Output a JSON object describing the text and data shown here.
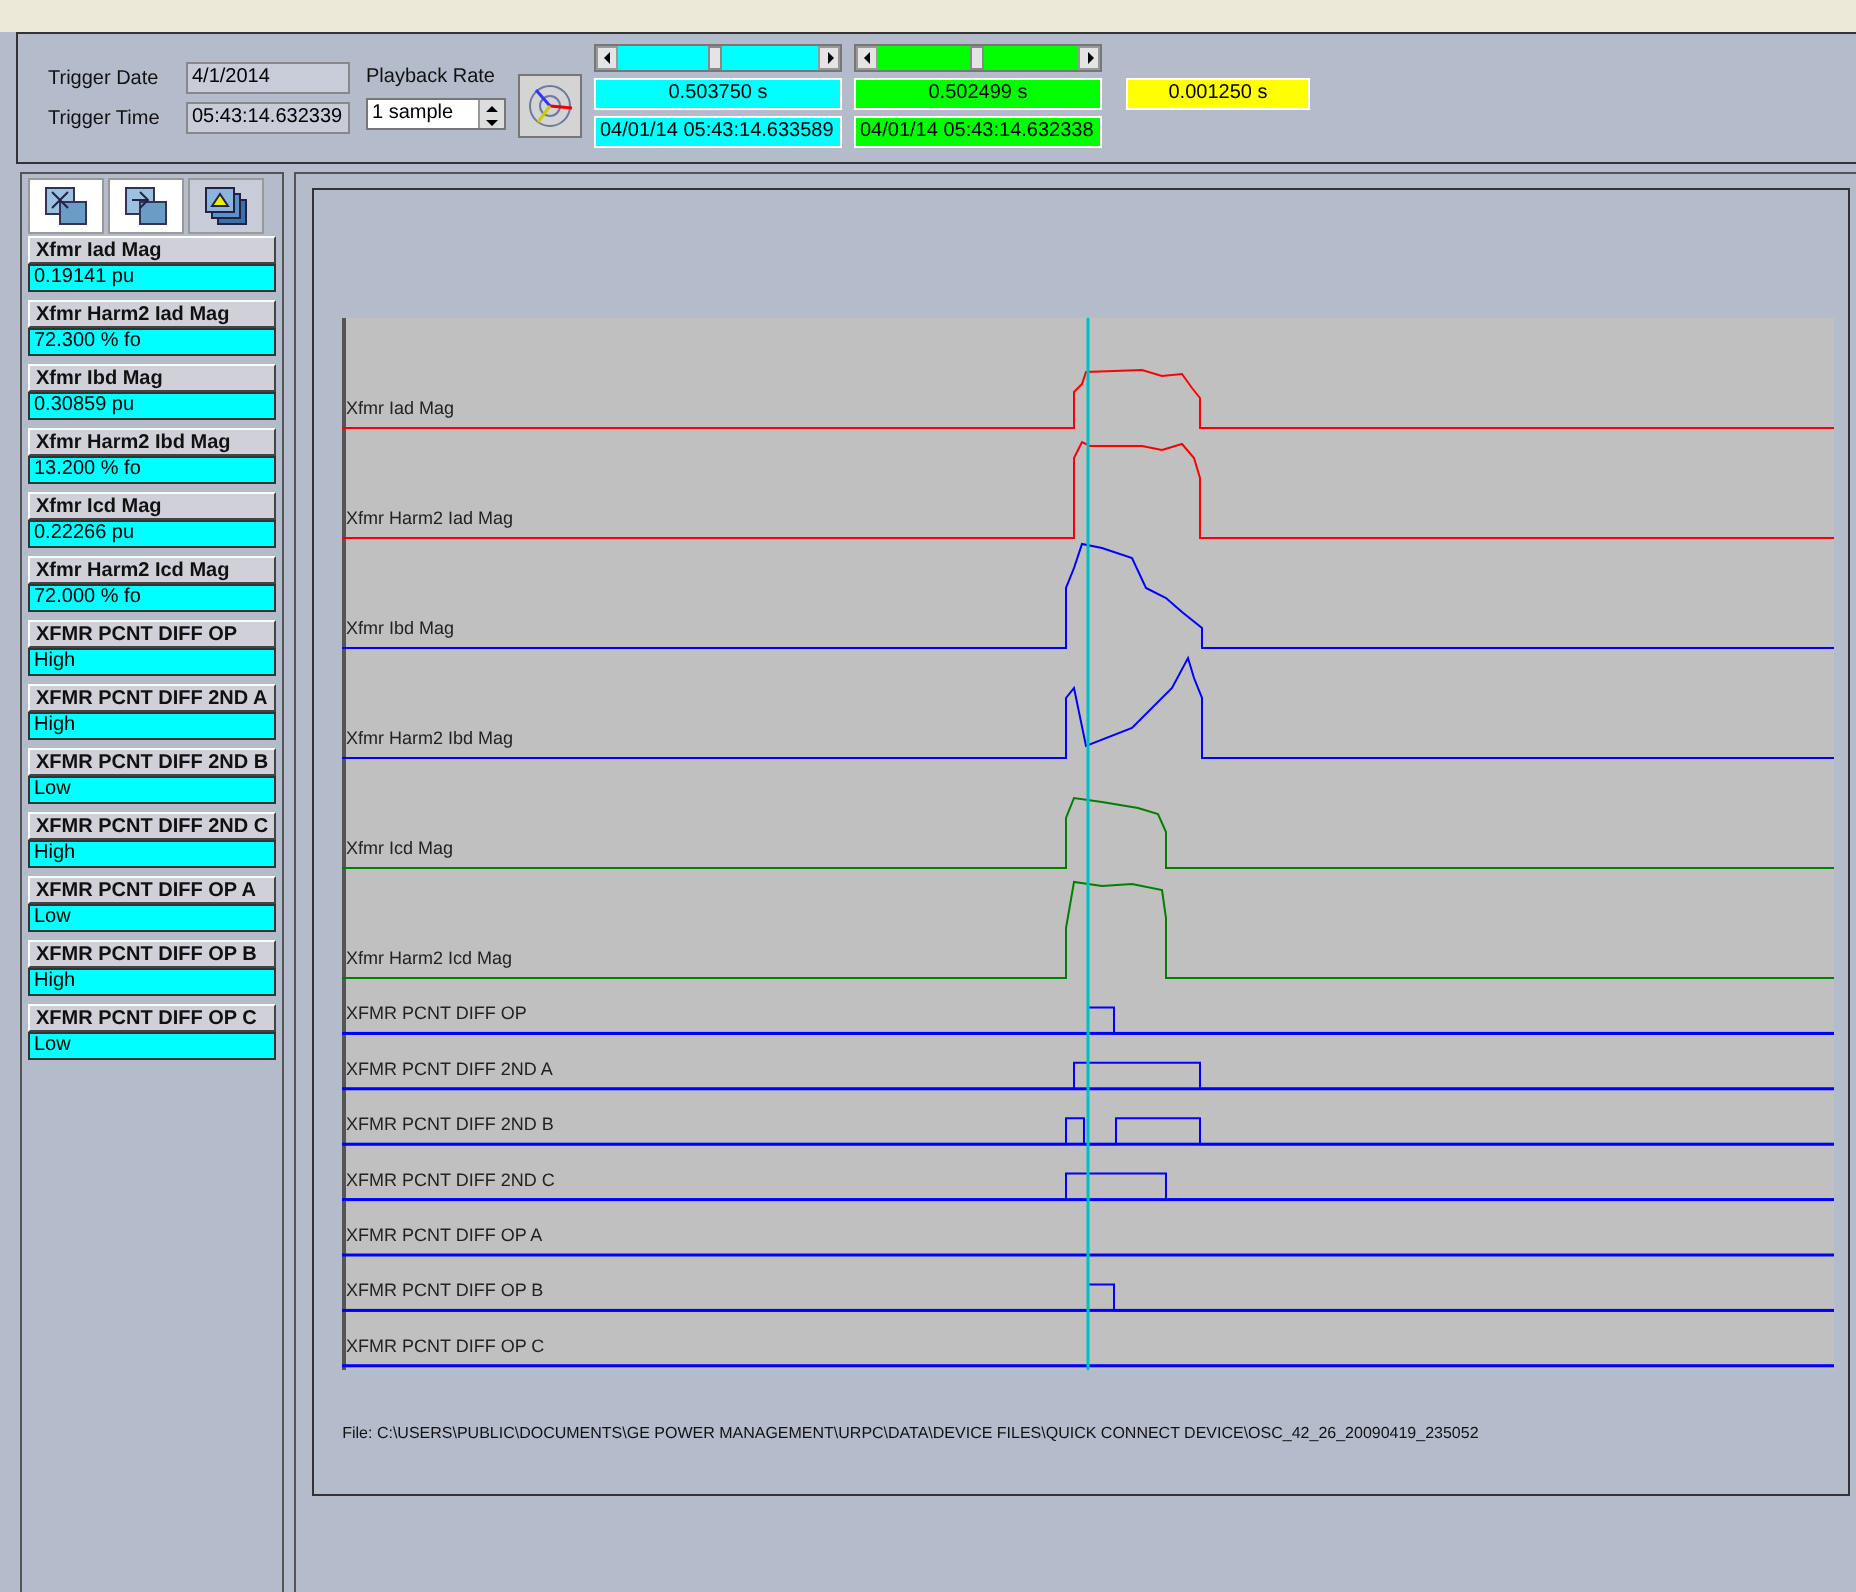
{
  "trigger": {
    "date_label": "Trigger Date",
    "date": "4/1/2014",
    "time_label": "Trigger Time",
    "time": "05:43:14.632339"
  },
  "playback": {
    "label": "Playback Rate",
    "value": "1 sample"
  },
  "cursors": [
    {
      "color": "#00ffff",
      "level": 0.49,
      "value": "0.503750 s",
      "timestamp": "04/01/14 05:43:14.633589"
    },
    {
      "color": "#00ff00",
      "level": 0.5,
      "value": "0.502499 s",
      "timestamp": "04/01/14 05:43:14.632338"
    }
  ],
  "delta": {
    "value": "0.001250 s"
  },
  "channels": [
    {
      "name": "Xfmr Iad Mag",
      "value": "0.19141 pu"
    },
    {
      "name": "Xfmr Harm2 Iad Mag",
      "value": "72.300 % fo"
    },
    {
      "name": "Xfmr Ibd Mag",
      "value": "0.30859 pu"
    },
    {
      "name": "Xfmr Harm2 Ibd Mag",
      "value": "13.200 % fo"
    },
    {
      "name": "Xfmr Icd Mag",
      "value": "0.22266 pu"
    },
    {
      "name": "Xfmr Harm2 Icd Mag",
      "value": "72.000 % fo"
    },
    {
      "name": "XFMR PCNT DIFF OP",
      "value": "High"
    },
    {
      "name": "XFMR PCNT DIFF 2ND A",
      "value": "High"
    },
    {
      "name": "XFMR PCNT DIFF 2ND B",
      "value": "Low"
    },
    {
      "name": "XFMR PCNT DIFF 2ND C",
      "value": "High"
    },
    {
      "name": "XFMR PCNT DIFF OP A",
      "value": "Low"
    },
    {
      "name": "XFMR PCNT DIFF OP B",
      "value": "High"
    },
    {
      "name": "XFMR PCNT DIFF OP C",
      "value": "Low"
    }
  ],
  "plot": {
    "traces": [
      {
        "name": "Xfmr Iad Mag",
        "kind": "analog",
        "color": "#ff0000"
      },
      {
        "name": "Xfmr Harm2 Iad Mag",
        "kind": "analog",
        "color": "#ff0000"
      },
      {
        "name": "Xfmr Ibd Mag",
        "kind": "analog",
        "color": "#0000ff"
      },
      {
        "name": "Xfmr Harm2 Ibd Mag",
        "kind": "analog",
        "color": "#0000ff"
      },
      {
        "name": "Xfmr Icd Mag",
        "kind": "analog",
        "color": "#008000"
      },
      {
        "name": "Xfmr Harm2 Icd Mag",
        "kind": "analog",
        "color": "#008000"
      },
      {
        "name": "XFMR PCNT DIFF OP",
        "kind": "digital",
        "color": "#0000ff"
      },
      {
        "name": "XFMR PCNT DIFF 2ND A",
        "kind": "digital",
        "color": "#0000ff"
      },
      {
        "name": "XFMR PCNT DIFF 2ND B",
        "kind": "digital",
        "color": "#0000ff"
      },
      {
        "name": "XFMR PCNT DIFF 2ND C",
        "kind": "digital",
        "color": "#0000ff"
      },
      {
        "name": "XFMR PCNT DIFF OP A",
        "kind": "digital",
        "color": "#0000ff"
      },
      {
        "name": "XFMR PCNT DIFF OP B",
        "kind": "digital",
        "color": "#0000ff"
      },
      {
        "name": "XFMR PCNT DIFF OP C",
        "kind": "digital",
        "color": "#0000ff"
      }
    ],
    "file": "File: C:\\USERS\\PUBLIC\\DOCUMENTS\\GE POWER MANAGEMENT\\URPC\\DATA\\DEVICE FILES\\QUICK CONNECT DEVICE\\OSC_42_26_20090419_235052"
  }
}
